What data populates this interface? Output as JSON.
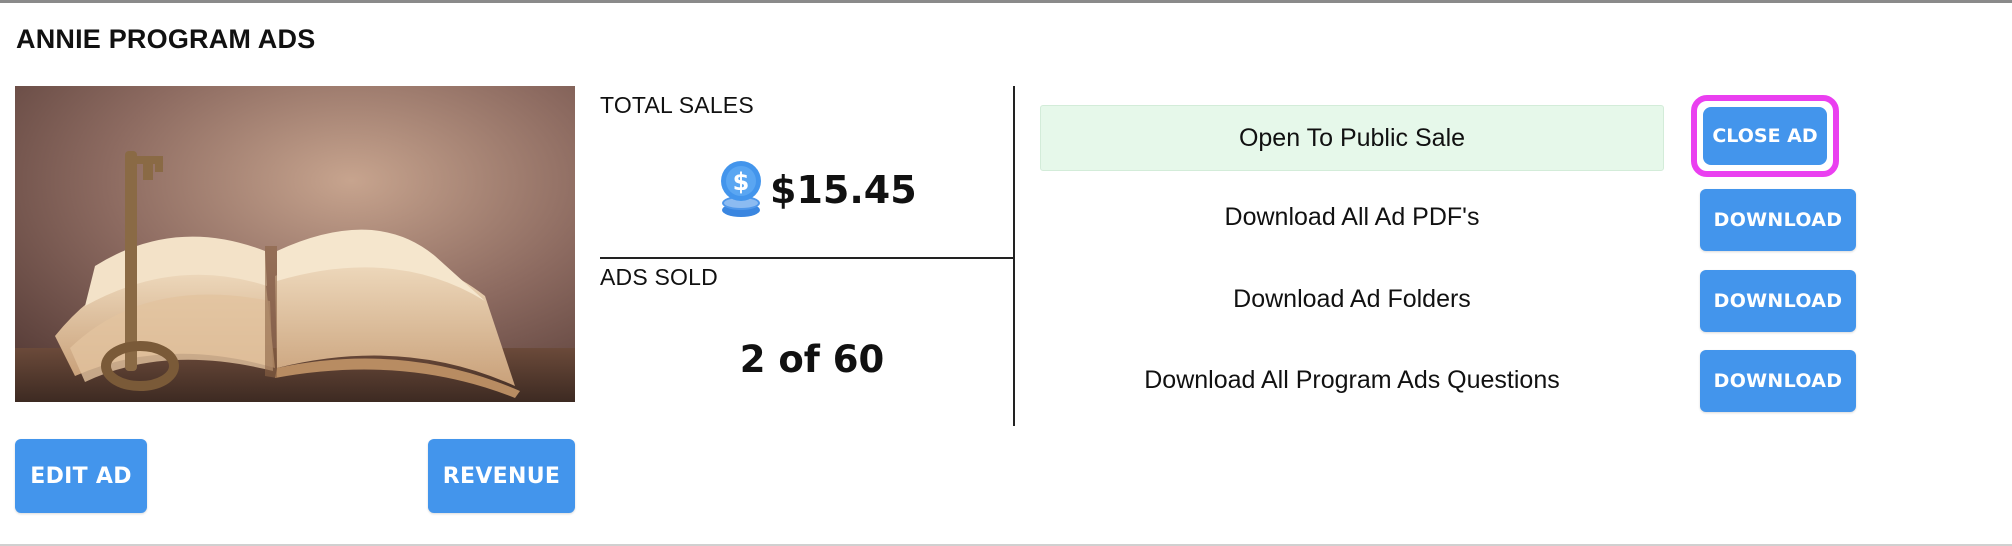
{
  "header": {
    "title": "ANNIE PROGRAM ADS"
  },
  "ad": {
    "image_description_icon": "book-with-key-image",
    "edit_label": "EDIT AD",
    "revenue_label": "REVENUE"
  },
  "stats": {
    "total_sales_label": "TOTAL SALES",
    "total_sales_value": "$15.45",
    "ads_sold_label": "ADS SOLD",
    "ads_sold_value": "2 of 60",
    "coin_icon": "dollar-coin-icon"
  },
  "actions": {
    "status_text": "Open To Public Sale",
    "close_label": "CLOSE AD",
    "rows": [
      {
        "label": "Download All Ad PDF's",
        "button": "DOWNLOAD"
      },
      {
        "label": "Download Ad Folders",
        "button": "DOWNLOAD"
      },
      {
        "label": "Download All Program Ads Questions",
        "button": "DOWNLOAD"
      }
    ]
  },
  "colors": {
    "accent": "#4395ec",
    "highlight": "#ea3ff0",
    "status_bg": "#e6f8ea"
  }
}
